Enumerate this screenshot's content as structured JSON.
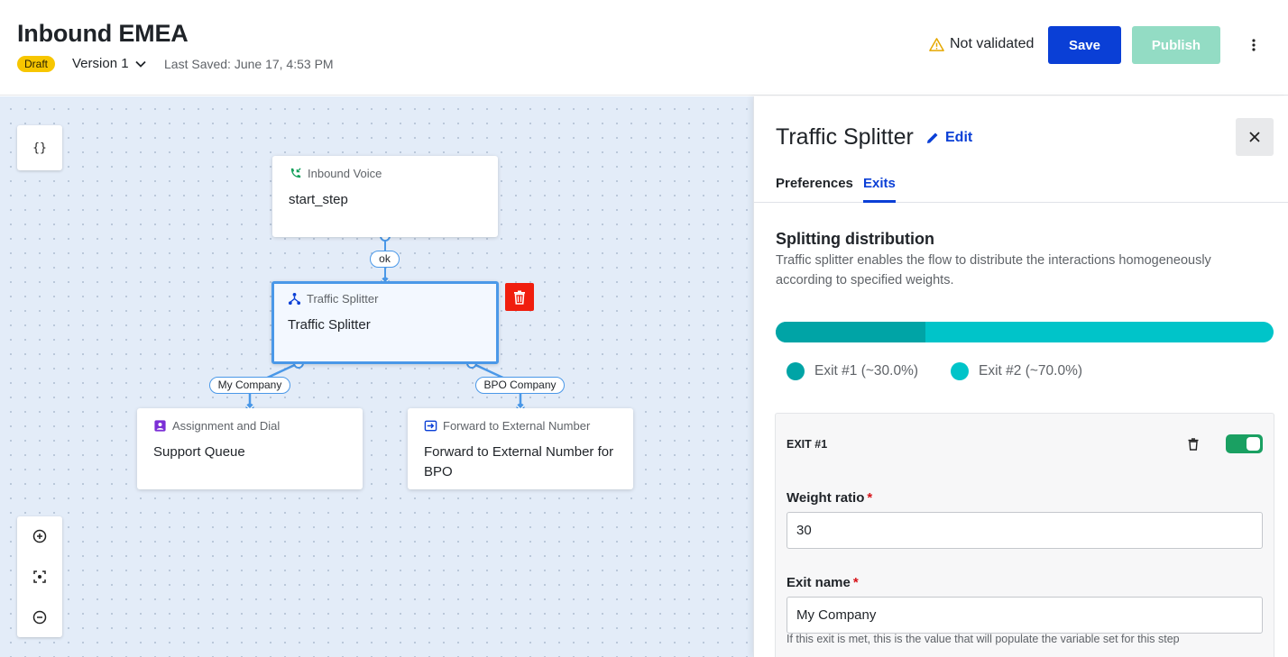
{
  "header": {
    "title": "Inbound EMEA",
    "status_badge": "Draft",
    "version_label": "Version 1",
    "last_saved": "Last Saved: June 17, 4:53 PM",
    "validation_text": "Not validated",
    "save_label": "Save",
    "publish_label": "Publish"
  },
  "canvas": {
    "code_button_label": "{}",
    "nodes": [
      {
        "type": "Inbound Voice",
        "name": "start_step",
        "icon": "phone-incoming-icon"
      },
      {
        "type": "Traffic Splitter",
        "name": "Traffic Splitter",
        "icon": "splitter-icon",
        "selected": true
      },
      {
        "type": "Assignment and Dial",
        "name": "Support Queue",
        "icon": "assignment-icon"
      },
      {
        "type": "Forward to External Number",
        "name": "Forward to External Number for BPO",
        "icon": "forward-icon"
      }
    ],
    "edge_labels": [
      "ok",
      "My Company",
      "BPO Company"
    ]
  },
  "panel": {
    "title": "Traffic Splitter",
    "edit_label": "Edit",
    "tabs": [
      {
        "label": "Preferences",
        "active": false
      },
      {
        "label": "Exits",
        "active": true
      }
    ],
    "section_title": "Splitting distribution",
    "section_desc": "Traffic splitter enables the flow to distribute the interactions homogeneously according to specified weights.",
    "distribution": [
      {
        "label": "Exit #1 (~30.0%)",
        "percent": 30,
        "color": "#00a4a6"
      },
      {
        "label": "Exit #2 (~70.0%)",
        "percent": 70,
        "color": "#00c4c9"
      }
    ],
    "exit_card": {
      "header": "EXIT #1",
      "enabled": true,
      "weight_label": "Weight ratio",
      "weight_value": "30",
      "exit_name_label": "Exit name",
      "exit_name_value": "My Company",
      "help_text": "If this exit is met, this is the value that will populate the variable set for this step"
    }
  },
  "colors": {
    "accent": "#0a3fd6",
    "draft": "#f7c600",
    "publish_disabled": "#93dcc4",
    "selection": "#4a98e8",
    "delete": "#f01e0e",
    "toggle_on": "#1aa062"
  }
}
